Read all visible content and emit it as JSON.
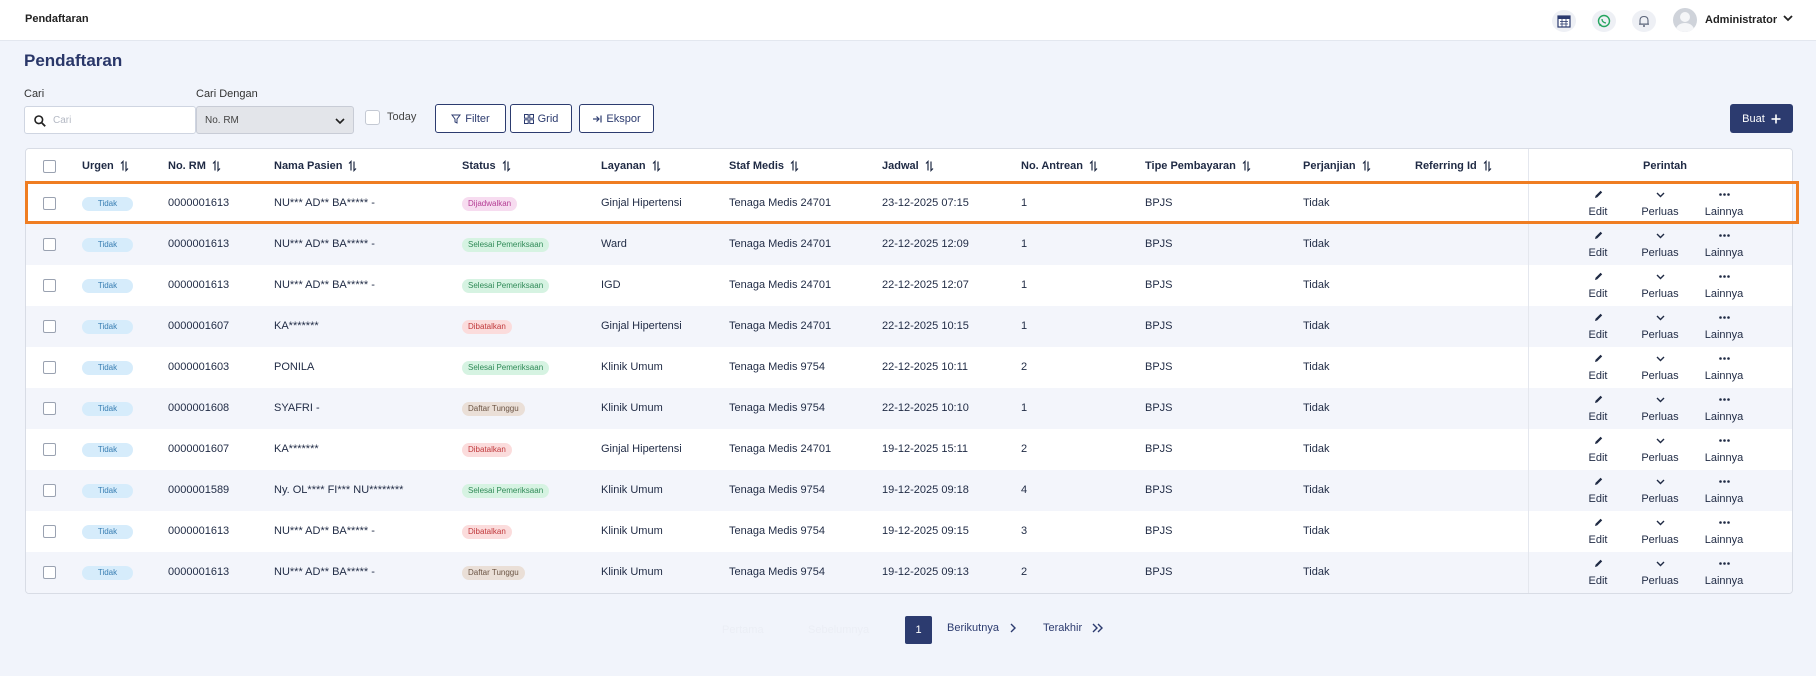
{
  "app": {
    "title": "Pendaftaran"
  },
  "user": {
    "name": "Administrator"
  },
  "page": {
    "title": "Pendaftaran"
  },
  "filters": {
    "search_label": "Cari",
    "search_placeholder": "Cari",
    "search_by_label": "Cari Dengan",
    "search_by_value": "No. RM",
    "today_label": "Today",
    "filter_button": "Filter",
    "grid_button": "Grid",
    "export_button": "Ekspor",
    "create_button": "Buat"
  },
  "table": {
    "headers": {
      "urgen": "Urgen",
      "no_rm": "No. RM",
      "nama_pasien": "Nama Pasien",
      "status": "Status",
      "layanan": "Layanan",
      "staf_medis": "Staf Medis",
      "jadwal": "Jadwal",
      "no_antrean": "No. Antrean",
      "tipe_pembayaran": "Tipe Pembayaran",
      "perjanjian": "Perjanjian",
      "referring_id": "Referring Id",
      "perintah": "Perintah"
    },
    "actions": {
      "edit": "Edit",
      "expand": "Perluas",
      "more": "Lainnya"
    },
    "rows": [
      {
        "urgen": "Tidak",
        "no_rm": "0000001613",
        "nama_pasien": "NU*** AD** BA***** -",
        "status": "Dijadwalkan",
        "layanan": "Ginjal Hipertensi",
        "staf_medis": "Tenaga Medis 24701",
        "jadwal": "23-12-2025 07:15",
        "no_antrean": "1",
        "tipe_pembayaran": "BPJS",
        "perjanjian": "Tidak",
        "referring_id": ""
      },
      {
        "urgen": "Tidak",
        "no_rm": "0000001613",
        "nama_pasien": "NU*** AD** BA***** -",
        "status": "Selesai Pemeriksaan",
        "layanan": "Ward",
        "staf_medis": "Tenaga Medis 24701",
        "jadwal": "22-12-2025 12:09",
        "no_antrean": "1",
        "tipe_pembayaran": "BPJS",
        "perjanjian": "Tidak",
        "referring_id": ""
      },
      {
        "urgen": "Tidak",
        "no_rm": "0000001613",
        "nama_pasien": "NU*** AD** BA***** -",
        "status": "Selesai Pemeriksaan",
        "layanan": "IGD",
        "staf_medis": "Tenaga Medis 24701",
        "jadwal": "22-12-2025 12:07",
        "no_antrean": "1",
        "tipe_pembayaran": "BPJS",
        "perjanjian": "Tidak",
        "referring_id": ""
      },
      {
        "urgen": "Tidak",
        "no_rm": "0000001607",
        "nama_pasien": "KA*******",
        "status": "Dibatalkan",
        "layanan": "Ginjal Hipertensi",
        "staf_medis": "Tenaga Medis 24701",
        "jadwal": "22-12-2025 10:15",
        "no_antrean": "1",
        "tipe_pembayaran": "BPJS",
        "perjanjian": "Tidak",
        "referring_id": ""
      },
      {
        "urgen": "Tidak",
        "no_rm": "0000001603",
        "nama_pasien": "PONILA",
        "status": "Selesai Pemeriksaan",
        "layanan": "Klinik Umum",
        "staf_medis": "Tenaga Medis 9754",
        "jadwal": "22-12-2025 10:11",
        "no_antrean": "2",
        "tipe_pembayaran": "BPJS",
        "perjanjian": "Tidak",
        "referring_id": ""
      },
      {
        "urgen": "Tidak",
        "no_rm": "0000001608",
        "nama_pasien": "SYAFRI -",
        "status": "Daftar Tunggu",
        "layanan": "Klinik Umum",
        "staf_medis": "Tenaga Medis 9754",
        "jadwal": "22-12-2025 10:10",
        "no_antrean": "1",
        "tipe_pembayaran": "BPJS",
        "perjanjian": "Tidak",
        "referring_id": ""
      },
      {
        "urgen": "Tidak",
        "no_rm": "0000001607",
        "nama_pasien": "KA*******",
        "status": "Dibatalkan",
        "layanan": "Ginjal Hipertensi",
        "staf_medis": "Tenaga Medis 24701",
        "jadwal": "19-12-2025 15:11",
        "no_antrean": "2",
        "tipe_pembayaran": "BPJS",
        "perjanjian": "Tidak",
        "referring_id": ""
      },
      {
        "urgen": "Tidak",
        "no_rm": "0000001589",
        "nama_pasien": "Ny. OL**** FI*** NU********",
        "status": "Selesai Pemeriksaan",
        "layanan": "Klinik Umum",
        "staf_medis": "Tenaga Medis 9754",
        "jadwal": "19-12-2025 09:18",
        "no_antrean": "4",
        "tipe_pembayaran": "BPJS",
        "perjanjian": "Tidak",
        "referring_id": ""
      },
      {
        "urgen": "Tidak",
        "no_rm": "0000001613",
        "nama_pasien": "NU*** AD** BA***** -",
        "status": "Dibatalkan",
        "layanan": "Klinik Umum",
        "staf_medis": "Tenaga Medis 9754",
        "jadwal": "19-12-2025 09:15",
        "no_antrean": "3",
        "tipe_pembayaran": "BPJS",
        "perjanjian": "Tidak",
        "referring_id": ""
      },
      {
        "urgen": "Tidak",
        "no_rm": "0000001613",
        "nama_pasien": "NU*** AD** BA***** -",
        "status": "Daftar Tunggu",
        "layanan": "Klinik Umum",
        "staf_medis": "Tenaga Medis 9754",
        "jadwal": "19-12-2025 09:13",
        "no_antrean": "2",
        "tipe_pembayaran": "BPJS",
        "perjanjian": "Tidak",
        "referring_id": ""
      }
    ]
  },
  "pagination": {
    "first": "Pertama",
    "previous": "Sebelumnya",
    "current_page": "1",
    "next": "Berikutnya",
    "last": "Terakhir"
  },
  "icons": {
    "calendar": "calendar-icon",
    "whatsapp": "whatsapp-icon",
    "notification": "bell-icon",
    "avatar": "user-avatar",
    "search": "search-icon",
    "filter": "filter-icon",
    "grid": "grid-icon",
    "export": "export-icon",
    "add": "plus-icon",
    "edit": "pencil-icon",
    "expand": "chevron-down-icon",
    "more": "more-dots-icon"
  },
  "colors": {
    "primary": "#2c3b6f",
    "highlight": "#ef7d22",
    "whatsapp": "#25a55f",
    "urgent_badge_bg": "#d6ecfb"
  }
}
